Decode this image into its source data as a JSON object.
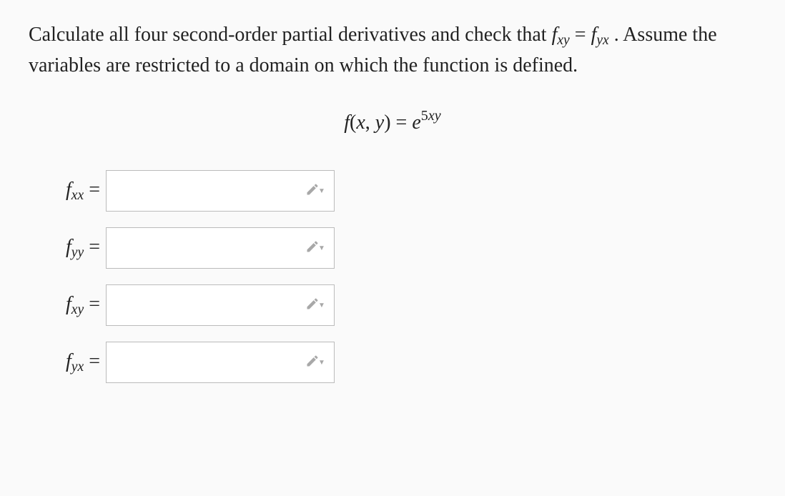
{
  "problem": {
    "line1_pre": "Calculate all four second-order partial derivatives and check that ",
    "eq_lhs": "f",
    "eq_lhs_sub": "xy",
    "eq_mid": " = ",
    "eq_rhs": "f",
    "eq_rhs_sub": "yx",
    "line1_post": ". Assume the variables are restricted to a domain on which the function is defined."
  },
  "equation": {
    "lhs_fn": "f",
    "lhs_args": "(x, y)",
    "eq": " = ",
    "rhs_base": "e",
    "rhs_exp_coeff": "5",
    "rhs_exp_vars": "xy"
  },
  "rows": [
    {
      "fvar": "f",
      "sub": "xx",
      "eq": " = ",
      "value": ""
    },
    {
      "fvar": "f",
      "sub": "yy",
      "eq": " = ",
      "value": ""
    },
    {
      "fvar": "f",
      "sub": "xy",
      "eq": " = ",
      "value": ""
    },
    {
      "fvar": "f",
      "sub": "yx",
      "eq": " = ",
      "value": ""
    }
  ]
}
